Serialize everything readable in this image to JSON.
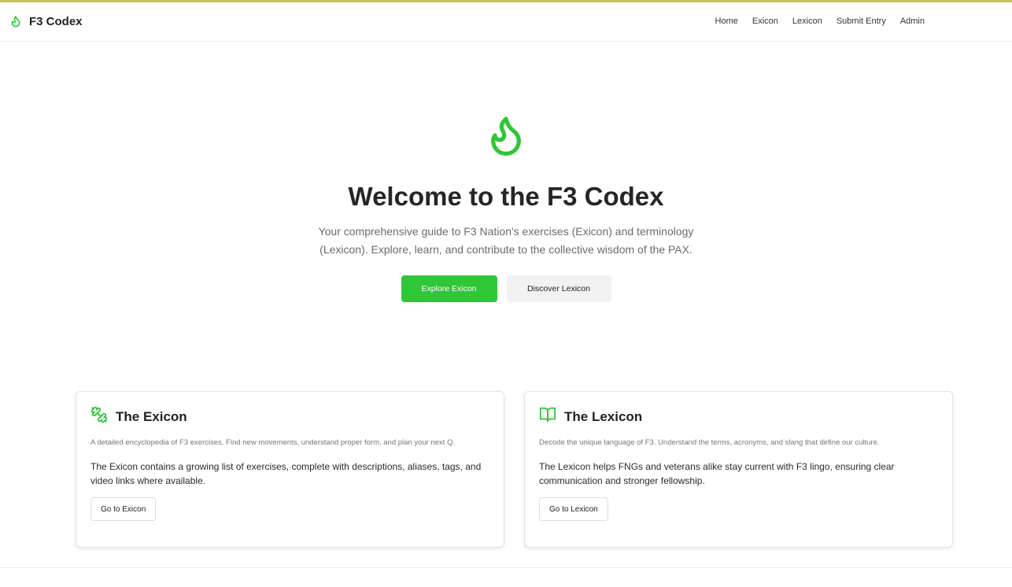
{
  "brand": {
    "name": "F3 Codex",
    "icon": "flame-icon",
    "accent": "#2fc637"
  },
  "nav": {
    "items": [
      {
        "label": "Home"
      },
      {
        "label": "Exicon"
      },
      {
        "label": "Lexicon"
      },
      {
        "label": "Submit Entry"
      },
      {
        "label": "Admin"
      }
    ]
  },
  "hero": {
    "icon": "flame-icon",
    "title": "Welcome to the F3 Codex",
    "subtitle": "Your comprehensive guide to F3 Nation's exercises (Exicon) and terminology (Lexicon). Explore, learn, and contribute to the collective wisdom of the PAX.",
    "primary_button": "Explore Exicon",
    "secondary_button": "Discover Lexicon"
  },
  "cards": {
    "exicon": {
      "icon": "dumbbell-icon",
      "title": "The Exicon",
      "description": "A detailed encyclopedia of F3 exercises. Find new movements, understand proper form, and plan your next Q.",
      "body": "The Exicon contains a growing list of exercises, complete with descriptions, aliases, tags, and video links where available.",
      "button": "Go to Exicon"
    },
    "lexicon": {
      "icon": "open-book-icon",
      "title": "The Lexicon",
      "description": "Decode the unique language of F3. Understand the terms, acronyms, and slang that define our culture.",
      "body": "The Lexicon helps FNGs and veterans alike stay current with F3 lingo, ensuring clear communication and stronger fellowship.",
      "button": "Go to Lexicon"
    }
  }
}
